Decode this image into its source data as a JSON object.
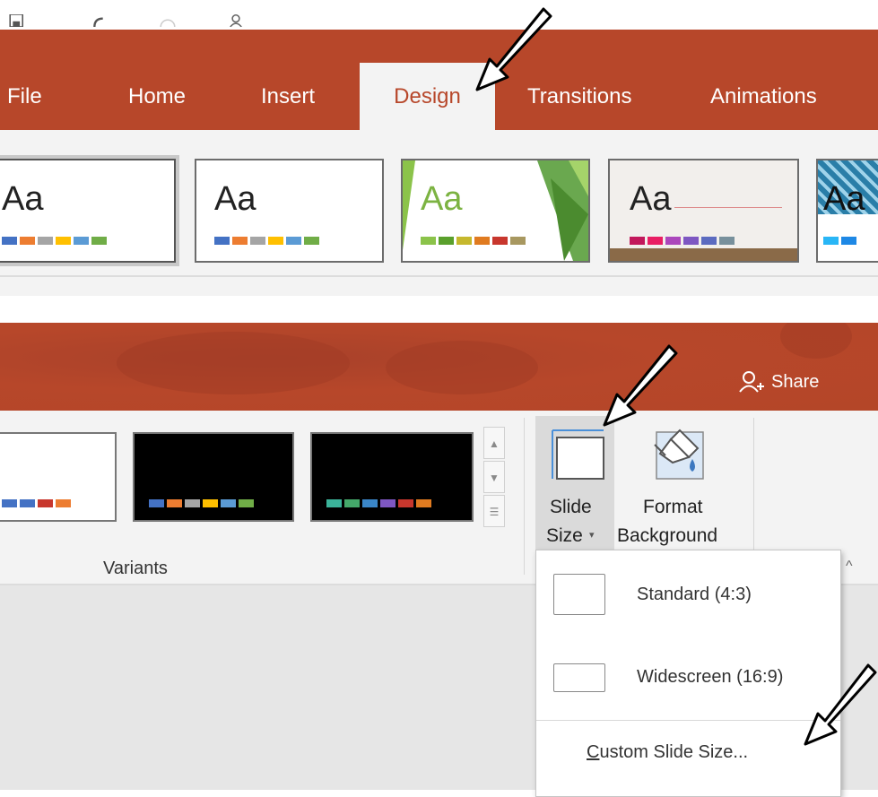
{
  "panel1": {
    "tabs": [
      "File",
      "Home",
      "Insert",
      "Design",
      "Transitions",
      "Animations"
    ],
    "active_tab": "Design",
    "themes": [
      {
        "sample": "Aa",
        "swatches": [
          "#4472c4",
          "#ed7d31",
          "#a5a5a5",
          "#ffc000",
          "#5b9bd5",
          "#70ad47"
        ]
      },
      {
        "sample": "Aa",
        "swatches": [
          "#4472c4",
          "#ed7d31",
          "#a5a5a5",
          "#ffc000",
          "#5b9bd5",
          "#70ad47"
        ]
      },
      {
        "sample": "Aa",
        "swatches": [
          "#8bc34a",
          "#5aa02c",
          "#c6b82d",
          "#e07b20",
          "#c8372d",
          "#a89860"
        ]
      },
      {
        "sample": "Aa",
        "swatches": [
          "#c2185b",
          "#e91e63",
          "#ab47bc",
          "#7e57c2",
          "#5c6bc0",
          "#78909c"
        ]
      },
      {
        "sample": "Aa",
        "swatches": [
          "#29b6f6",
          "#1e88e5"
        ]
      }
    ]
  },
  "panel2": {
    "share_label": "Share",
    "variants": [
      {
        "bg": "#ffffff",
        "swatches": [
          "#4472c4",
          "#4472c4",
          "#c8372d",
          "#ed7d31"
        ]
      },
      {
        "bg": "#000000",
        "swatches": [
          "#4472c4",
          "#ed7d31",
          "#a5a5a5",
          "#ffc000",
          "#5b9bd5",
          "#70ad47"
        ]
      },
      {
        "bg": "#000000",
        "swatches": [
          "#3bb39a",
          "#44a86a",
          "#3a86c8",
          "#7e57c2",
          "#c8372d",
          "#e07b20"
        ]
      }
    ],
    "variants_group_label": "Variants",
    "slide_size_label_1": "Slide",
    "slide_size_label_2": "Size",
    "format_bg_label_1": "Format",
    "format_bg_label_2": "Background",
    "dropdown": {
      "standard_label": "Standard (4:3)",
      "widescreen_label": "Widescreen (16:9)",
      "custom_label_first": "C",
      "custom_label_rest": "ustom Slide Size..."
    }
  }
}
